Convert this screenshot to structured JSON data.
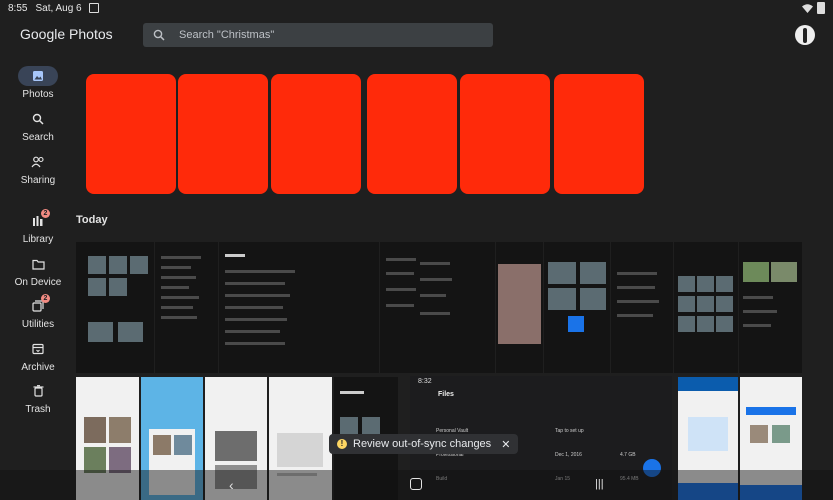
{
  "status_bar": {
    "time": "8:55",
    "date": "Sat, Aug 6"
  },
  "app": {
    "title": "Google Photos"
  },
  "search": {
    "placeholder": "Search \"Christmas\""
  },
  "sidebar": {
    "items": [
      {
        "label": "Photos",
        "icon": "photo-icon",
        "active": true
      },
      {
        "label": "Search",
        "icon": "search-icon",
        "active": false
      },
      {
        "label": "Sharing",
        "icon": "people-icon",
        "active": false
      },
      {
        "label": "Library",
        "icon": "library-icon",
        "active": false,
        "badge": "2"
      },
      {
        "label": "On Device",
        "icon": "folder-icon",
        "active": false
      },
      {
        "label": "Utilities",
        "icon": "utilities-icon",
        "active": false,
        "badge": "2"
      },
      {
        "label": "Archive",
        "icon": "archive-icon",
        "active": false
      },
      {
        "label": "Trash",
        "icon": "trash-icon",
        "active": false
      }
    ]
  },
  "memories": {
    "count": 6,
    "color": "#ff2a0a"
  },
  "section": {
    "title": "Today"
  },
  "files_overlay": {
    "time": "8:32",
    "title": "Files",
    "rows": [
      {
        "name": "Personal Vault",
        "col2": "Tap to set up",
        "col3": ""
      },
      {
        "name": "Professional",
        "col2": "Dec 1, 2016",
        "col3": "4.7 GB"
      },
      {
        "name": "Build",
        "col2": "Jan 15",
        "col3": "95.4 MB"
      }
    ]
  },
  "toast": {
    "message": "Review out-of-sync changes"
  },
  "colors": {
    "background": "#1f1f1f",
    "accent": "#394457",
    "badge": "#f28b82",
    "warning": "#fdd663"
  }
}
